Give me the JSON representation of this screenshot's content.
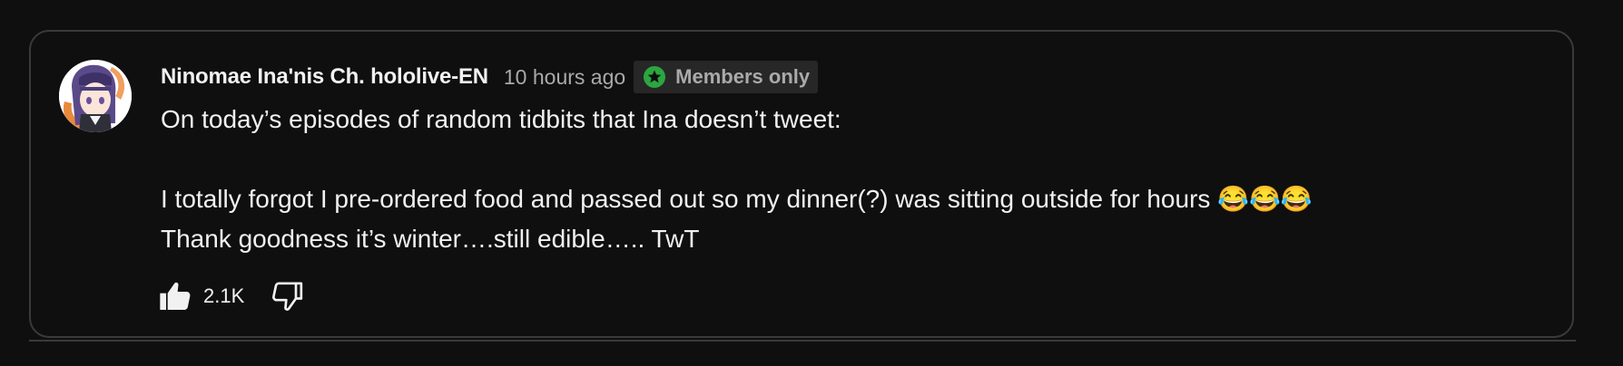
{
  "post": {
    "author": "Ninomae Ina'nis Ch. hololive-EN",
    "time": "10 hours ago",
    "badge": "Members only",
    "body_lines": [
      "On today’s episodes of random tidbits that Ina doesn’t tweet:",
      "I totally forgot I pre-ordered food and passed out so my dinner(?) was sitting outside for hours 😂😂😂",
      "Thank goodness it’s winter….still edible….. TwT"
    ],
    "likes": "2.1K"
  },
  "icons": {
    "badge_icon": "star-in-circle-icon",
    "like_icon": "thumbs-up-icon",
    "dislike_icon": "thumbs-down-icon"
  },
  "colors": {
    "background": "#0f0f0f",
    "border": "#3a3a3a",
    "text_primary": "#f1f1f1",
    "text_secondary": "#aaaaaa",
    "badge_bg": "#272727",
    "badge_icon": "#2ba640"
  }
}
